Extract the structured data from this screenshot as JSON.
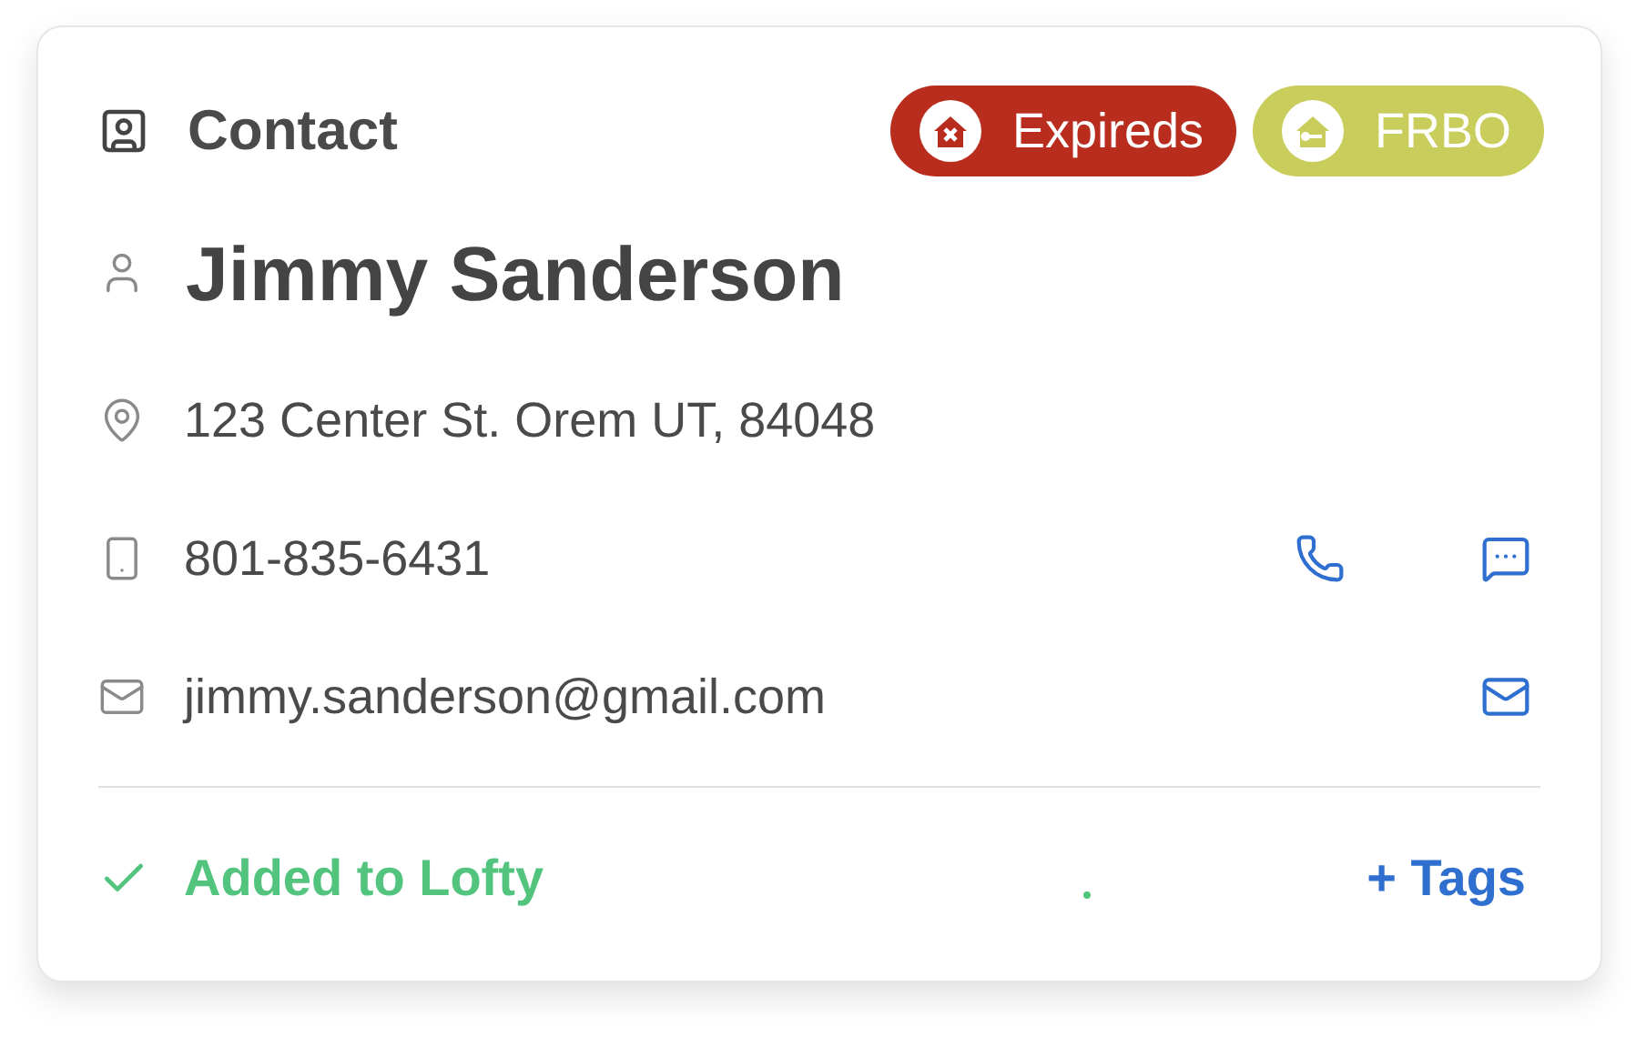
{
  "card": {
    "title": "Contact",
    "tags": [
      {
        "label": "Expireds",
        "color": "#b92d1f",
        "kind": "expired"
      },
      {
        "label": "FRBO",
        "color": "#c9cd5c",
        "kind": "rent"
      }
    ],
    "name": "Jimmy Sanderson",
    "rows": [
      {
        "kind": "address",
        "text": "123 Center St. Orem UT, 84048",
        "actions": []
      },
      {
        "kind": "phone",
        "text": "801-835-6431",
        "actions": [
          {
            "kind": "call"
          },
          {
            "kind": "message"
          }
        ]
      },
      {
        "kind": "email",
        "text": "jimmy.sanderson@gmail.com",
        "actions": [
          {
            "kind": "email"
          }
        ]
      }
    ],
    "status": "Added to Lofty",
    "tags_button": "+ Tags"
  }
}
